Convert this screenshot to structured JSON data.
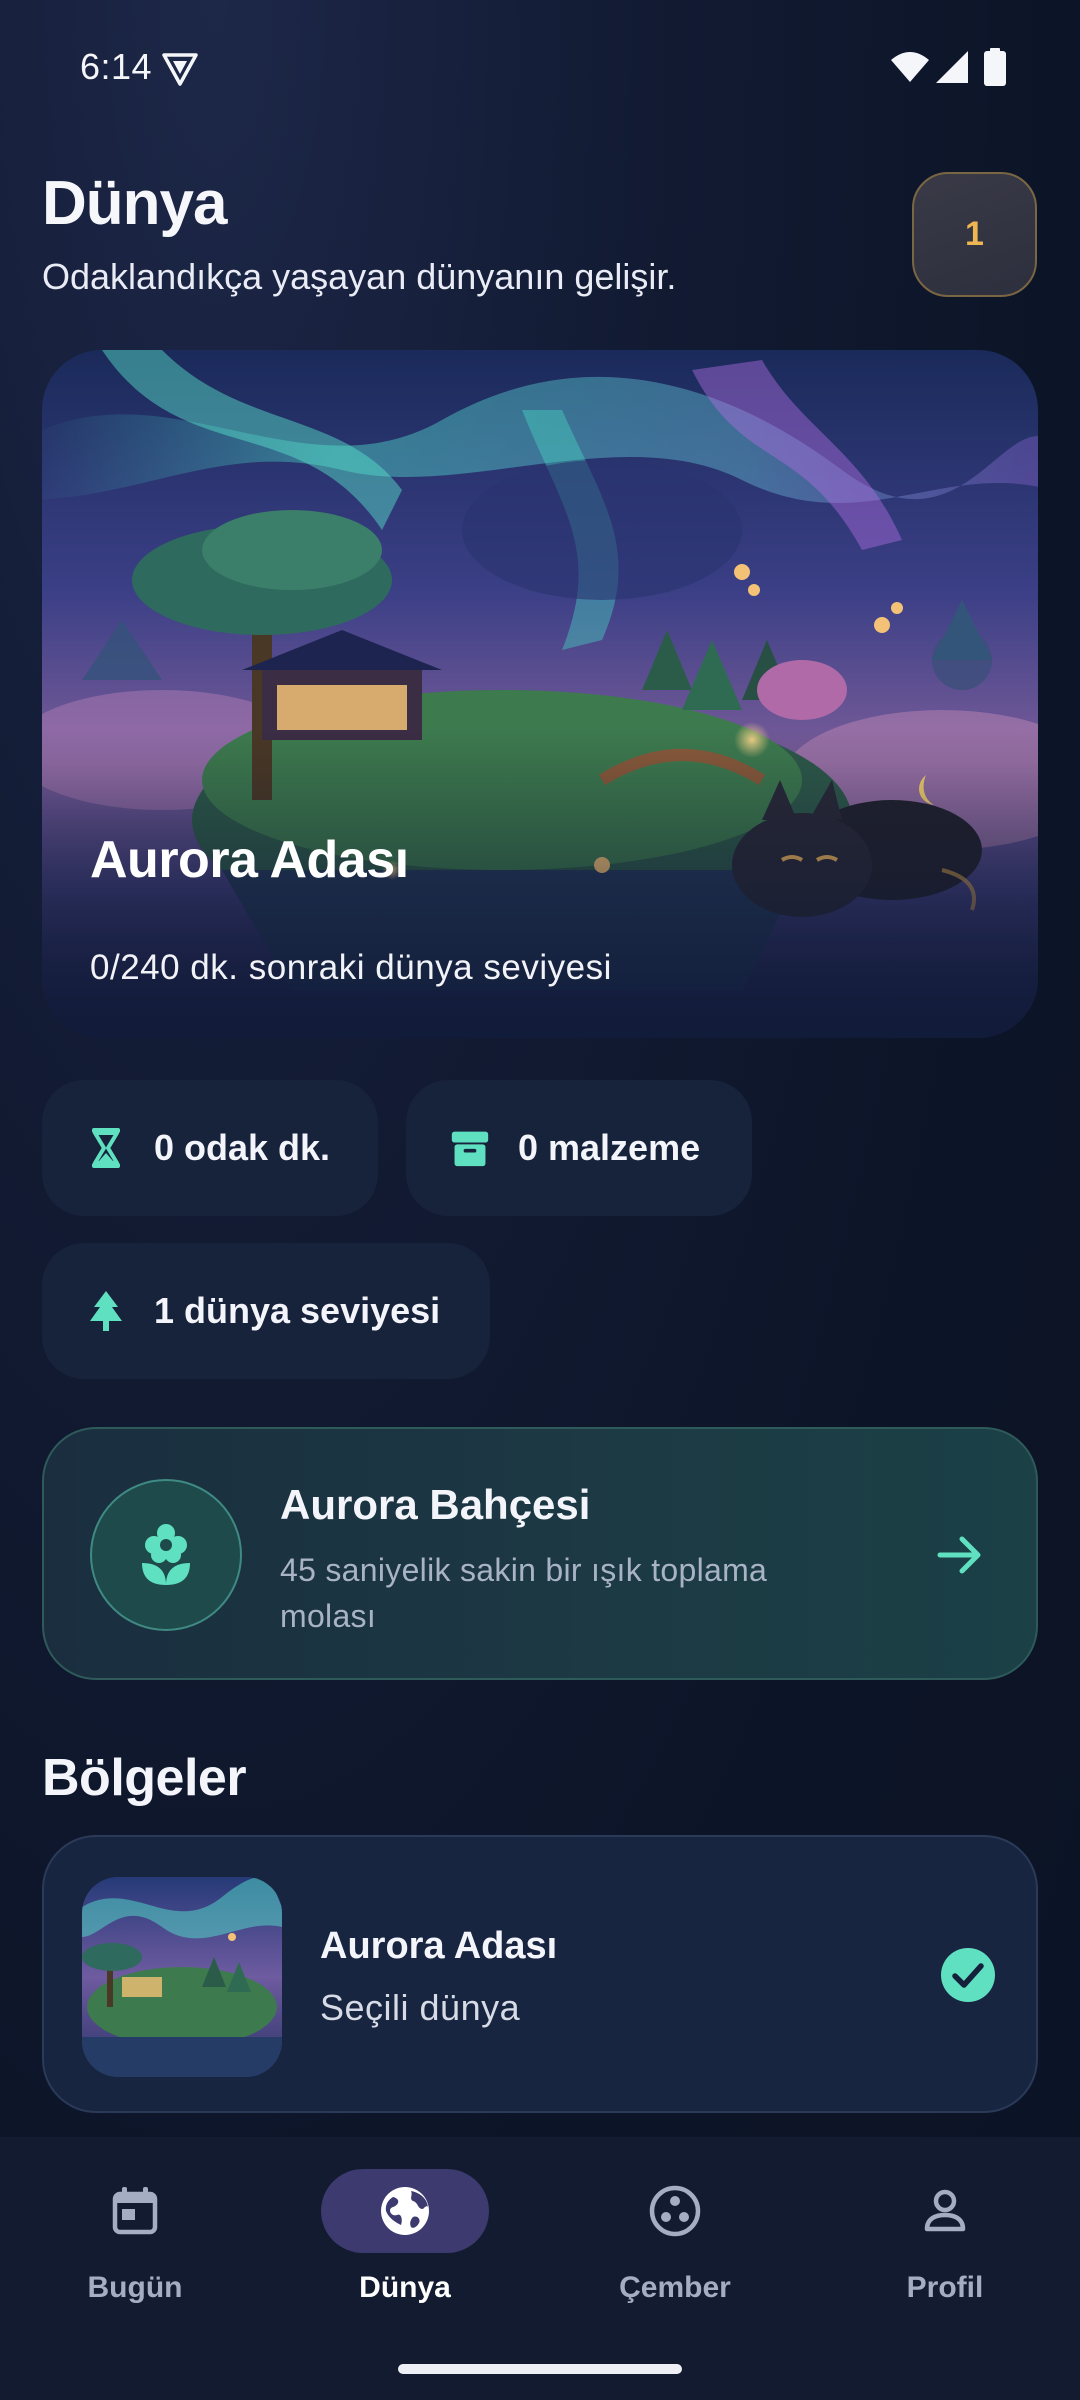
{
  "status_bar": {
    "time": "6:14"
  },
  "header": {
    "title": "Dünya",
    "subtitle": "Odaklandıkça yaşayan dünyanın gelişir.",
    "level_badge": "1"
  },
  "hero": {
    "world_name": "Aurora Adası",
    "progress_text": "0/240 dk. sonraki dünya seviyesi",
    "progress_fraction": 0
  },
  "stats": {
    "focus_minutes": "0 odak dk.",
    "materials": "0 malzeme",
    "world_level": "1 dünya seviyesi"
  },
  "garden": {
    "title": "Aurora Bahçesi",
    "description": "45 saniyelik sakin bir ışık toplama molası"
  },
  "regions": {
    "section_title": "Bölgeler",
    "items": [
      {
        "name": "Aurora Adası",
        "status": "Seçili dünya",
        "selected": true
      }
    ]
  },
  "nav": {
    "items": [
      {
        "label": "Bugün",
        "icon": "calendar-icon",
        "active": false
      },
      {
        "label": "Dünya",
        "icon": "globe-icon",
        "active": true
      },
      {
        "label": "Çember",
        "icon": "circle-group-icon",
        "active": false
      },
      {
        "label": "Profil",
        "icon": "person-icon",
        "active": false
      }
    ]
  },
  "colors": {
    "accent_teal": "#5fe0c0",
    "badge_gold": "#f0b553",
    "nav_active_pill": "#3c3a6e",
    "background": "#0c1427"
  }
}
